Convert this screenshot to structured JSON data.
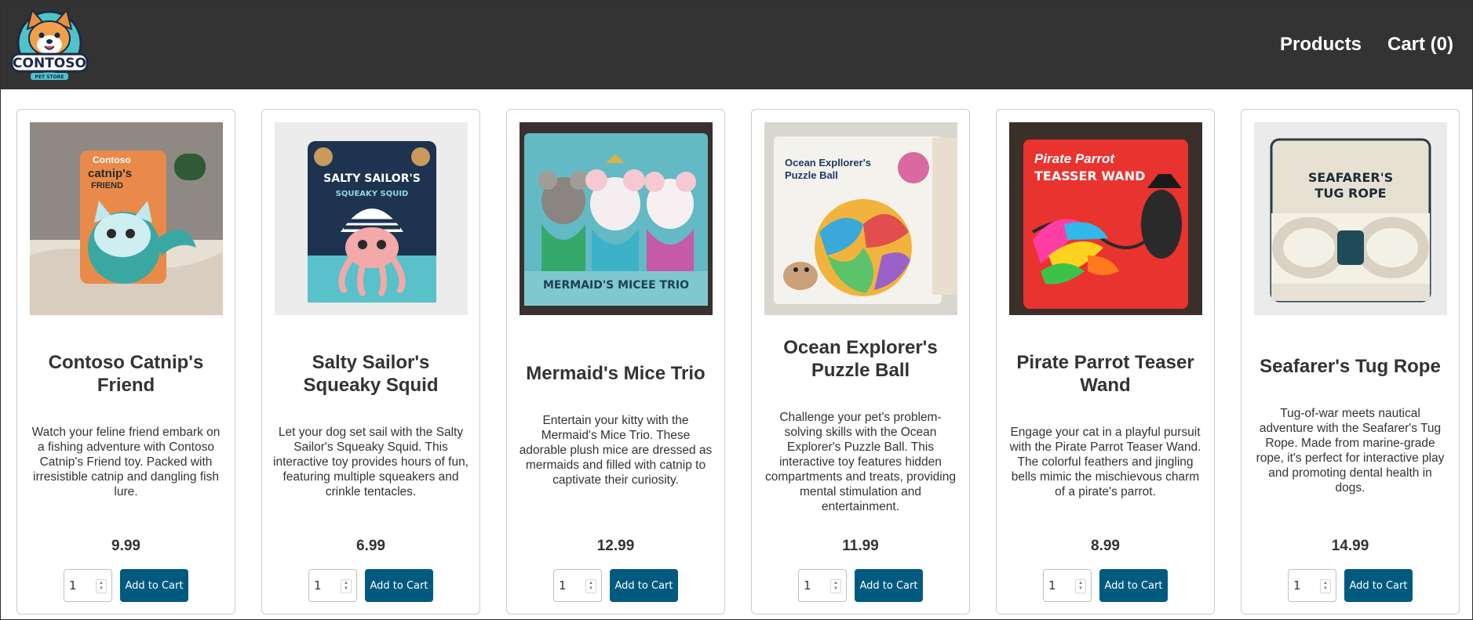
{
  "brand": {
    "name": "CONTOSO",
    "tagline": "PET STORE"
  },
  "nav": {
    "products": "Products",
    "cart": "Cart (0)"
  },
  "add_label": "Add to Cart",
  "colors": {
    "navbar": "#333333",
    "button": "#005a80",
    "card_border": "#cccccc"
  },
  "products": [
    {
      "title": "Contoso Catnip's Friend",
      "description": "Watch your feline friend embark on a fishing adventure with Contoso Catnip's Friend toy. Packed with irresistible catnip and dangling fish lure.",
      "price": "9.99",
      "quantity": "1",
      "package_lines": [
        "Contoso",
        "catnip's",
        "FRIEND"
      ]
    },
    {
      "title": "Salty Sailor's Squeaky Squid",
      "description": "Let your dog set sail with the Salty Sailor's Squeaky Squid. This interactive toy provides hours of fun, featuring multiple squeakers and crinkle tentacles.",
      "price": "6.99",
      "quantity": "1",
      "package_lines": [
        "SALTY SAILOR'S",
        "SQUEAKY SQUID"
      ]
    },
    {
      "title": "Mermaid's Mice Trio",
      "description": "Entertain your kitty with the Mermaid's Mice Trio. These adorable plush mice are dressed as mermaids and filled with catnip to captivate their curiosity.",
      "price": "12.99",
      "quantity": "1",
      "package_lines": [
        "MERMAID'S MICEE TRIO"
      ]
    },
    {
      "title": "Ocean Explorer's Puzzle Ball",
      "description": "Challenge your pet's problem-solving skills with the Ocean Explorer's Puzzle Ball. This interactive toy features hidden compartments and treats, providing mental stimulation and entertainment.",
      "price": "11.99",
      "quantity": "1",
      "package_lines": [
        "Ocean Expllorer's",
        "Puzzle Ball"
      ]
    },
    {
      "title": "Pirate Parrot Teaser Wand",
      "description": "Engage your cat in a playful pursuit with the Pirate Parrot Teaser Wand. The colorful feathers and jingling bells mimic the mischievous charm of a pirate's parrot.",
      "price": "8.99",
      "quantity": "1",
      "package_lines": [
        "Pirate Parrot",
        "TEASSER WAND"
      ]
    },
    {
      "title": "Seafarer's Tug Rope",
      "description": "Tug-of-war meets nautical adventure with the Seafarer's Tug Rope. Made from marine-grade rope, it's perfect for interactive play and promoting dental health in dogs.",
      "price": "14.99",
      "quantity": "1",
      "package_lines": [
        "SEAFARER'S",
        "TUG ROPE"
      ]
    }
  ]
}
